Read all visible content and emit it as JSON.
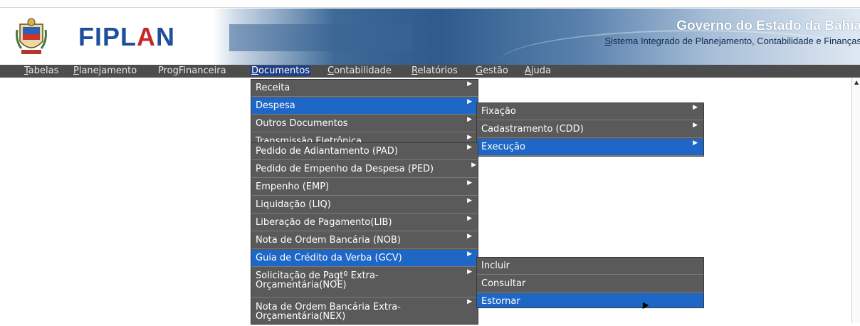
{
  "header": {
    "logo_prefix": "FIPL",
    "logo_accent": "A",
    "logo_suffix": "N",
    "title": "Governo do Estado da Bahia",
    "subtitle_underlined": "S",
    "subtitle_rest": "istema Integrado de Planejamento, Contabilidade e Finanças",
    "seal_icon": "state-seal-icon"
  },
  "menubar": {
    "items": [
      {
        "mn": "T",
        "rest": "abelas"
      },
      {
        "mn": "P",
        "rest": "lanejamento"
      },
      {
        "pre": "Pro",
        "mn": "g",
        "rest": "Financeira"
      },
      {
        "mn": "D",
        "rest": "ocumentos"
      },
      {
        "mn": "C",
        "rest": "ontabilidade"
      },
      {
        "mn": "R",
        "rest": "elatórios"
      },
      {
        "mn": "G",
        "rest": "estão"
      },
      {
        "mn": "A",
        "rest": "juda"
      }
    ],
    "active_color": "#1f3f86",
    "bar_color": "#4d4d4d"
  },
  "menu_documentos": {
    "items": [
      "Receita",
      "Despesa",
      "Outros Documentos",
      "Transmissão Eletrônica"
    ],
    "selected": "Despesa"
  },
  "menu_despesa": {
    "items": [
      "Fixação",
      "Cadastramento (CDD)",
      "Execução"
    ],
    "selected": "Execução"
  },
  "menu_execucao": {
    "items": [
      "Pedido de Adiantamento (PAD)",
      "Pedido de Empenho da Despesa (PED)",
      "Empenho (EMP)",
      "Liquidação (LIQ)",
      "Liberação de Pagamento(LIB)",
      "Nota de Ordem Bancária (NOB)",
      "Guia de Crédito da Verba (GCV)",
      "Solicitação de Pagtº Extra-Orçamentária(NOE)",
      "Nota de Ordem Bancária Extra-Orçamentária(NEX)"
    ],
    "selected": "Guia de Crédito da Verba (GCV)"
  },
  "menu_gcv": {
    "items": [
      "Incluir",
      "Consultar",
      "Estornar"
    ],
    "selected": "Estornar"
  },
  "colors": {
    "menu_bg": "#5a5a5a",
    "menu_selected": "#1f67c6",
    "logo_blue": "#1f4f9a",
    "logo_red": "#c62828"
  }
}
